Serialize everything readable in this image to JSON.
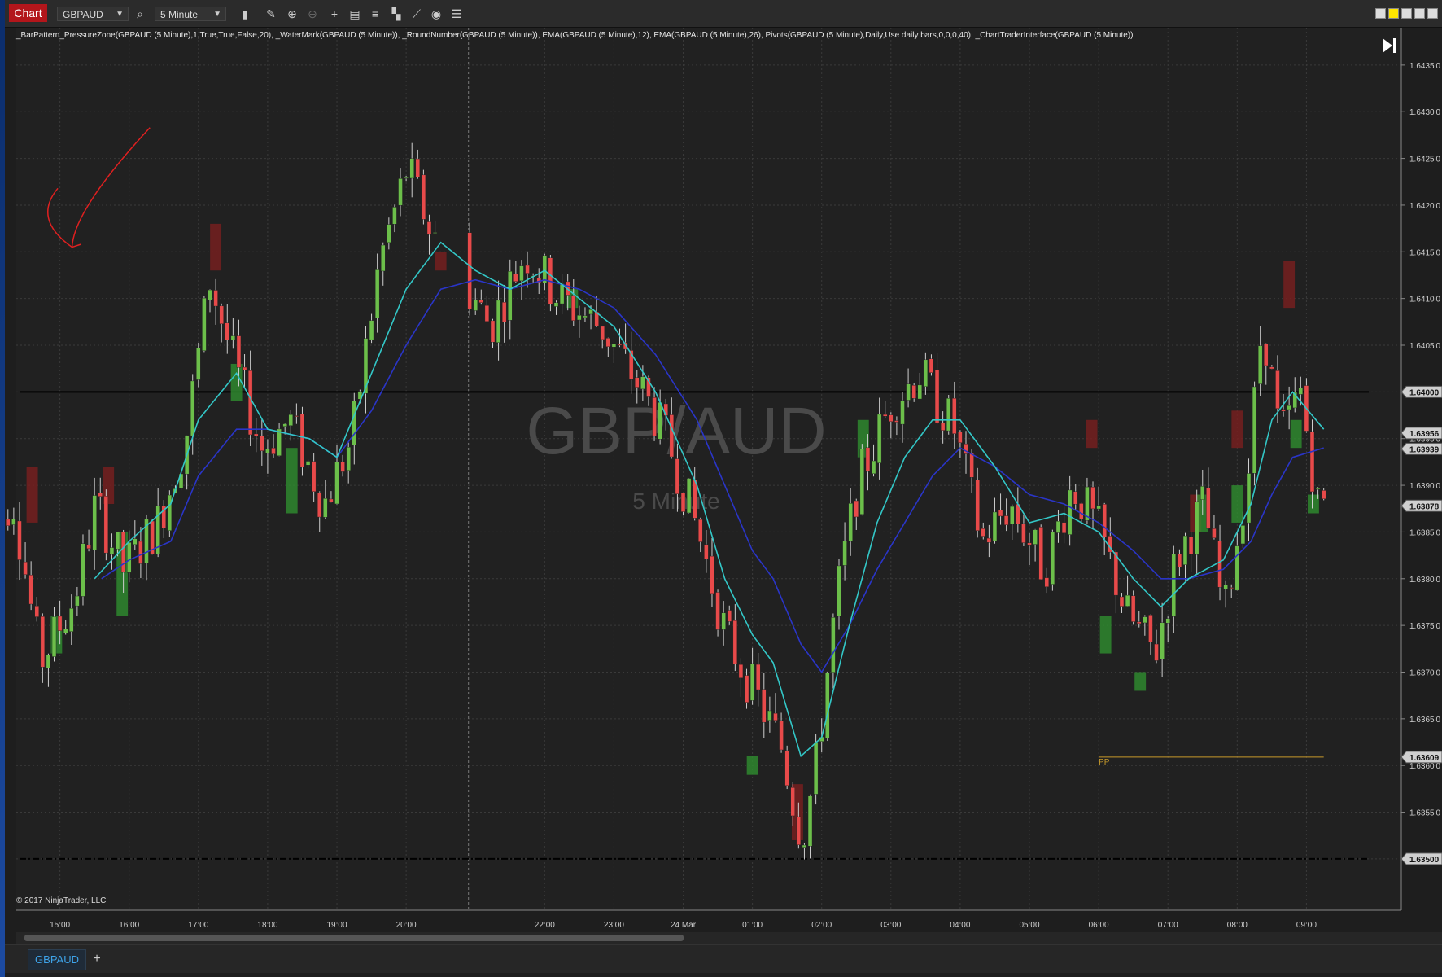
{
  "toolbar": {
    "chart_label": "Chart",
    "instrument": "GBPAUD",
    "interval": "5 Minute",
    "icons": [
      "bar-style-icon",
      "draw-pencil-icon",
      "zoom-in-icon",
      "zoom-out-icon",
      "crosshair-icon",
      "data-box-icon",
      "indicators-icon",
      "strategies-icon",
      "drawing-tools-icon",
      "properties-icon",
      "list-icon"
    ]
  },
  "indicators_text": "_BarPattern_PressureZone(GBPAUD (5 Minute),1,True,True,False,20), _WaterMark(GBPAUD (5 Minute)), _RoundNumber(GBPAUD (5 Minute)), EMA(GBPAUD (5 Minute),12), EMA(GBPAUD (5 Minute),26), Pivots(GBPAUD (5 Minute),Daily,Use daily bars,0,0,0,40), _ChartTraderInterface(GBPAUD (5 Minute))",
  "watermark": {
    "symbol": "GBP/AUD",
    "period": "5 Minute"
  },
  "copyright": "© 2017 NinjaTrader, LLC",
  "tab": {
    "label": "GBPAUD",
    "add": "+"
  },
  "colors": {
    "up": "#6cbf4a",
    "down": "#e84a4a",
    "ema12": "#33c7c7",
    "ema26": "#2a35c8",
    "pivot": "#c89a2a",
    "zone_up": "#2f8f2f",
    "zone_down": "#7a1f1f",
    "annotation": "#e02020"
  },
  "chart_data": {
    "type": "candlestick",
    "symbol": "GBPAUD",
    "y_tick_labels": [
      "1.6435'0",
      "1.6430'0",
      "1.6425'0",
      "1.6420'0",
      "1.6415'0",
      "1.6410'0",
      "1.6405'0",
      "1.6400",
      "1.6395'0",
      "1.6390'0",
      "1.6385'0",
      "1.6380'0",
      "1.6375'0",
      "1.6370'0",
      "1.6365'0",
      "1.6360'0",
      "1.6355'0",
      "1.6350'0"
    ],
    "y_ticks": [
      1.6435,
      1.643,
      1.6425,
      1.642,
      1.6415,
      1.641,
      1.6405,
      1.64,
      1.6395,
      1.639,
      1.6385,
      1.638,
      1.6375,
      1.637,
      1.6365,
      1.636,
      1.6355,
      1.635
    ],
    "ylim": [
      1.63445,
      1.6439
    ],
    "x_labels": [
      "15:00",
      "16:00",
      "17:00",
      "18:00",
      "19:00",
      "20:00",
      "22:00",
      "23:00",
      "24 Mar",
      "01:00",
      "02:00",
      "03:00",
      "04:00",
      "05:00",
      "06:00",
      "07:00",
      "08:00",
      "09:00"
    ],
    "x_hours": [
      1,
      2,
      3,
      4,
      5,
      6,
      8,
      9,
      10,
      11,
      12,
      13,
      14,
      15,
      16,
      17,
      18,
      19
    ],
    "x_range": [
      0.37,
      20.37
    ],
    "price_markers": [
      {
        "label": "1.64000",
        "value": 1.64
      },
      {
        "label": "1.63956",
        "value": 1.63956
      },
      {
        "label": "1.63939",
        "value": 1.63939
      },
      {
        "label": "1.63878",
        "value": 1.63878
      },
      {
        "label": "1.63609",
        "value": 1.63609
      },
      {
        "label": "1.63500",
        "value": 1.635
      }
    ],
    "horizontal_lines": [
      {
        "value": 1.64,
        "style": "solid",
        "color": "#000000"
      },
      {
        "value": 1.635,
        "style": "dash-dot",
        "color": "#000000"
      }
    ],
    "pivot": {
      "label": "PP",
      "value": 1.63609,
      "from_hour": 16.0,
      "to_hour": 19.25
    },
    "session_line_hour": 6.9,
    "key_points": [
      {
        "hour": 0.0,
        "price": 1.6383
      },
      {
        "hour": 0.4,
        "price": 1.6389
      },
      {
        "hour": 0.8,
        "price": 1.6371
      },
      {
        "hour": 1.3,
        "price": 1.6378
      },
      {
        "hour": 1.6,
        "price": 1.6388
      },
      {
        "hour": 2.0,
        "price": 1.6381
      },
      {
        "hour": 2.5,
        "price": 1.6386
      },
      {
        "hour": 2.9,
        "price": 1.6395
      },
      {
        "hour": 3.25,
        "price": 1.6412
      },
      {
        "hour": 3.6,
        "price": 1.6403
      },
      {
        "hour": 4.0,
        "price": 1.6394
      },
      {
        "hour": 4.4,
        "price": 1.6397
      },
      {
        "hour": 4.9,
        "price": 1.6388
      },
      {
        "hour": 5.3,
        "price": 1.6395
      },
      {
        "hour": 5.7,
        "price": 1.6414
      },
      {
        "hour": 6.1,
        "price": 1.6424
      },
      {
        "hour": 6.45,
        "price": 1.6417
      },
      {
        "hour": 6.9,
        "price": 1.6412
      },
      {
        "hour": 7.3,
        "price": 1.6407
      },
      {
        "hour": 7.8,
        "price": 1.6415
      },
      {
        "hour": 8.3,
        "price": 1.641
      },
      {
        "hour": 8.9,
        "price": 1.6407
      },
      {
        "hour": 9.5,
        "price": 1.64
      },
      {
        "hour": 9.9,
        "price": 1.6394
      },
      {
        "hour": 10.3,
        "price": 1.6385
      },
      {
        "hour": 10.7,
        "price": 1.6374
      },
      {
        "hour": 11.1,
        "price": 1.6368
      },
      {
        "hour": 11.5,
        "price": 1.6362
      },
      {
        "hour": 11.8,
        "price": 1.6352
      },
      {
        "hour": 12.0,
        "price": 1.636
      },
      {
        "hour": 12.3,
        "price": 1.6378
      },
      {
        "hour": 12.6,
        "price": 1.639
      },
      {
        "hour": 13.1,
        "price": 1.6399
      },
      {
        "hour": 13.5,
        "price": 1.6402
      },
      {
        "hour": 14.0,
        "price": 1.6396
      },
      {
        "hour": 14.4,
        "price": 1.6384
      },
      {
        "hour": 14.8,
        "price": 1.6388
      },
      {
        "hour": 15.3,
        "price": 1.6381
      },
      {
        "hour": 15.7,
        "price": 1.639
      },
      {
        "hour": 16.1,
        "price": 1.6385
      },
      {
        "hour": 16.5,
        "price": 1.6376
      },
      {
        "hour": 16.9,
        "price": 1.6372
      },
      {
        "hour": 17.2,
        "price": 1.6382
      },
      {
        "hour": 17.6,
        "price": 1.6388
      },
      {
        "hour": 17.9,
        "price": 1.6376
      },
      {
        "hour": 18.25,
        "price": 1.6392
      },
      {
        "hour": 18.45,
        "price": 1.6408
      },
      {
        "hour": 18.7,
        "price": 1.6395
      },
      {
        "hour": 19.0,
        "price": 1.64
      },
      {
        "hour": 19.25,
        "price": 1.6388
      }
    ],
    "ema12_points": [
      {
        "hour": 1.5,
        "price": 1.638
      },
      {
        "hour": 2.0,
        "price": 1.6384
      },
      {
        "hour": 2.6,
        "price": 1.6388
      },
      {
        "hour": 3.0,
        "price": 1.6397
      },
      {
        "hour": 3.55,
        "price": 1.6402
      },
      {
        "hour": 4.0,
        "price": 1.6396
      },
      {
        "hour": 4.6,
        "price": 1.6395
      },
      {
        "hour": 5.0,
        "price": 1.6393
      },
      {
        "hour": 5.5,
        "price": 1.6402
      },
      {
        "hour": 6.0,
        "price": 1.6411
      },
      {
        "hour": 6.5,
        "price": 1.6416
      },
      {
        "hour": 7.0,
        "price": 1.6413
      },
      {
        "hour": 7.5,
        "price": 1.6411
      },
      {
        "hour": 8.0,
        "price": 1.6413
      },
      {
        "hour": 8.5,
        "price": 1.641
      },
      {
        "hour": 9.0,
        "price": 1.6407
      },
      {
        "hour": 9.6,
        "price": 1.64
      },
      {
        "hour": 10.2,
        "price": 1.639
      },
      {
        "hour": 10.6,
        "price": 1.638
      },
      {
        "hour": 11.0,
        "price": 1.6374
      },
      {
        "hour": 11.3,
        "price": 1.6371
      },
      {
        "hour": 11.7,
        "price": 1.6361
      },
      {
        "hour": 12.0,
        "price": 1.6363
      },
      {
        "hour": 12.4,
        "price": 1.6375
      },
      {
        "hour": 12.8,
        "price": 1.6386
      },
      {
        "hour": 13.2,
        "price": 1.6393
      },
      {
        "hour": 13.6,
        "price": 1.6397
      },
      {
        "hour": 14.0,
        "price": 1.6397
      },
      {
        "hour": 14.5,
        "price": 1.6392
      },
      {
        "hour": 15.0,
        "price": 1.6386
      },
      {
        "hour": 15.5,
        "price": 1.6387
      },
      {
        "hour": 16.0,
        "price": 1.6385
      },
      {
        "hour": 16.5,
        "price": 1.638
      },
      {
        "hour": 16.9,
        "price": 1.6377
      },
      {
        "hour": 17.3,
        "price": 1.638
      },
      {
        "hour": 17.8,
        "price": 1.6382
      },
      {
        "hour": 18.2,
        "price": 1.6388
      },
      {
        "hour": 18.5,
        "price": 1.6397
      },
      {
        "hour": 18.8,
        "price": 1.64
      },
      {
        "hour": 19.25,
        "price": 1.6396
      }
    ],
    "ema26_points": [
      {
        "hour": 1.6,
        "price": 1.638
      },
      {
        "hour": 2.0,
        "price": 1.6382
      },
      {
        "hour": 2.6,
        "price": 1.6384
      },
      {
        "hour": 3.0,
        "price": 1.6391
      },
      {
        "hour": 3.55,
        "price": 1.6396
      },
      {
        "hour": 4.0,
        "price": 1.6396
      },
      {
        "hour": 4.6,
        "price": 1.6395
      },
      {
        "hour": 5.0,
        "price": 1.6393
      },
      {
        "hour": 5.5,
        "price": 1.6398
      },
      {
        "hour": 6.0,
        "price": 1.6405
      },
      {
        "hour": 6.5,
        "price": 1.6411
      },
      {
        "hour": 7.0,
        "price": 1.6412
      },
      {
        "hour": 7.5,
        "price": 1.6411
      },
      {
        "hour": 8.0,
        "price": 1.6412
      },
      {
        "hour": 8.5,
        "price": 1.6411
      },
      {
        "hour": 9.0,
        "price": 1.6409
      },
      {
        "hour": 9.6,
        "price": 1.6404
      },
      {
        "hour": 10.2,
        "price": 1.6397
      },
      {
        "hour": 10.6,
        "price": 1.639
      },
      {
        "hour": 11.0,
        "price": 1.6383
      },
      {
        "hour": 11.3,
        "price": 1.638
      },
      {
        "hour": 11.7,
        "price": 1.6373
      },
      {
        "hour": 12.0,
        "price": 1.637
      },
      {
        "hour": 12.4,
        "price": 1.6375
      },
      {
        "hour": 12.8,
        "price": 1.6381
      },
      {
        "hour": 13.2,
        "price": 1.6386
      },
      {
        "hour": 13.6,
        "price": 1.6391
      },
      {
        "hour": 14.0,
        "price": 1.6394
      },
      {
        "hour": 14.5,
        "price": 1.6392
      },
      {
        "hour": 15.0,
        "price": 1.6389
      },
      {
        "hour": 15.5,
        "price": 1.6388
      },
      {
        "hour": 16.0,
        "price": 1.6386
      },
      {
        "hour": 16.5,
        "price": 1.6383
      },
      {
        "hour": 16.9,
        "price": 1.638
      },
      {
        "hour": 17.3,
        "price": 1.638
      },
      {
        "hour": 17.8,
        "price": 1.6381
      },
      {
        "hour": 18.2,
        "price": 1.6384
      },
      {
        "hour": 18.5,
        "price": 1.6389
      },
      {
        "hour": 18.8,
        "price": 1.6393
      },
      {
        "hour": 19.25,
        "price": 1.6394
      }
    ],
    "zones": [
      {
        "hour": 0.6,
        "lo": 1.6386,
        "hi": 1.6392,
        "dir": "down"
      },
      {
        "hour": 0.95,
        "lo": 1.6372,
        "hi": 1.6376,
        "dir": "up"
      },
      {
        "hour": 1.7,
        "lo": 1.6388,
        "hi": 1.6392,
        "dir": "down"
      },
      {
        "hour": 1.9,
        "lo": 1.6376,
        "hi": 1.6385,
        "dir": "up"
      },
      {
        "hour": 3.25,
        "lo": 1.6413,
        "hi": 1.6418,
        "dir": "down"
      },
      {
        "hour": 3.55,
        "lo": 1.6399,
        "hi": 1.6403,
        "dir": "up"
      },
      {
        "hour": 4.35,
        "lo": 1.6387,
        "hi": 1.6394,
        "dir": "up"
      },
      {
        "hour": 6.5,
        "lo": 1.6413,
        "hi": 1.6415,
        "dir": "down"
      },
      {
        "hour": 8.4,
        "lo": 1.6409,
        "hi": 1.6411,
        "dir": "up"
      },
      {
        "hour": 11.0,
        "lo": 1.6359,
        "hi": 1.6361,
        "dir": "up"
      },
      {
        "hour": 11.65,
        "lo": 1.6352,
        "hi": 1.6358,
        "dir": "down"
      },
      {
        "hour": 12.6,
        "lo": 1.6393,
        "hi": 1.6397,
        "dir": "up"
      },
      {
        "hour": 15.9,
        "lo": 1.6394,
        "hi": 1.6397,
        "dir": "down"
      },
      {
        "hour": 16.1,
        "lo": 1.6372,
        "hi": 1.6376,
        "dir": "up"
      },
      {
        "hour": 16.6,
        "lo": 1.6368,
        "hi": 1.637,
        "dir": "up"
      },
      {
        "hour": 17.4,
        "lo": 1.6385,
        "hi": 1.6389,
        "dir": "down"
      },
      {
        "hour": 17.5,
        "lo": 1.6385,
        "hi": 1.6389,
        "dir": "up"
      },
      {
        "hour": 18.0,
        "lo": 1.6386,
        "hi": 1.639,
        "dir": "up"
      },
      {
        "hour": 18.0,
        "lo": 1.6394,
        "hi": 1.6398,
        "dir": "down"
      },
      {
        "hour": 18.75,
        "lo": 1.6409,
        "hi": 1.6414,
        "dir": "down"
      },
      {
        "hour": 18.85,
        "lo": 1.6394,
        "hi": 1.6397,
        "dir": "up"
      },
      {
        "hour": 19.1,
        "lo": 1.6387,
        "hi": 1.6389,
        "dir": "up"
      }
    ]
  }
}
